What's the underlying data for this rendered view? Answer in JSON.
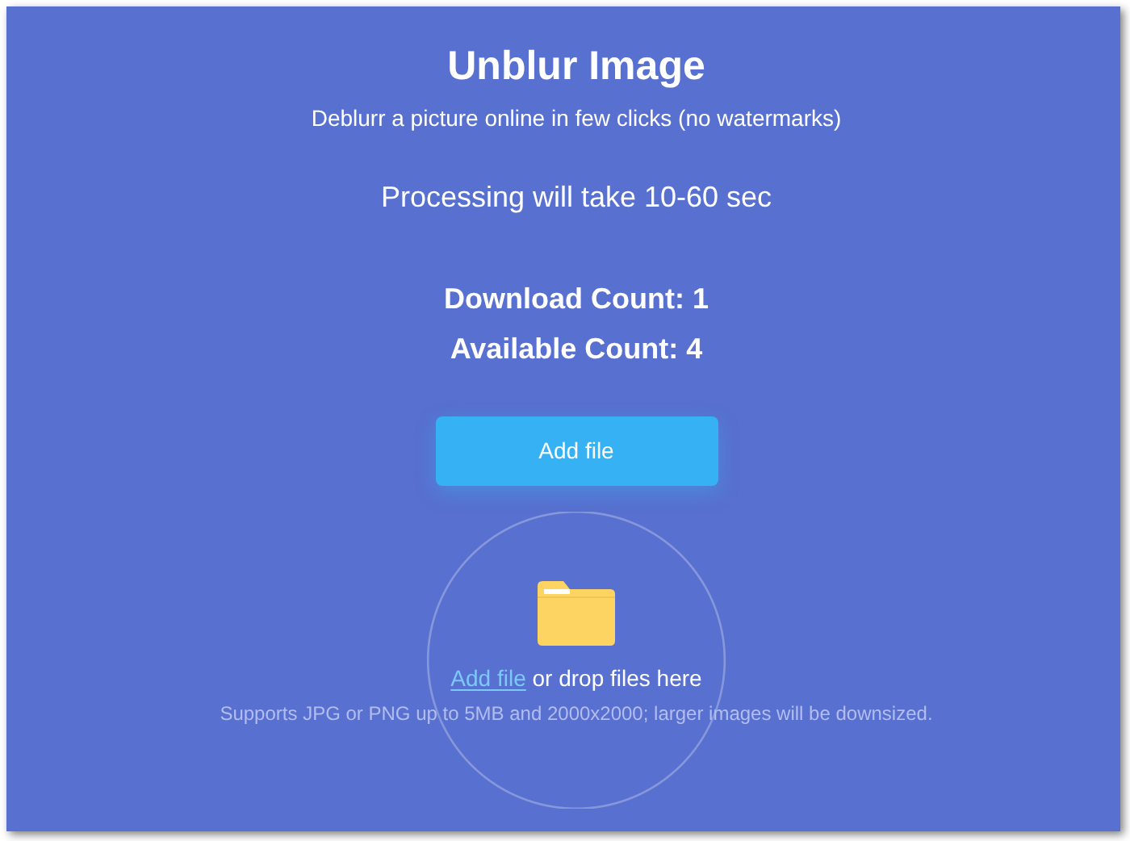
{
  "title": "Unblur Image",
  "subtitle": "Deblurr a picture online in few clicks (no watermarks)",
  "processing_note": "Processing will take 10-60 sec",
  "counts": [
    {
      "text": "Download Count: 1"
    },
    {
      "text": "Available Count: 4"
    }
  ],
  "add_button": "Add file",
  "drop_zone": {
    "link": "Add file",
    "text": "or drop files here",
    "note": "Supports JPG or PNG up to 5MB and 2000x2000; larger images will be downsized."
  }
}
